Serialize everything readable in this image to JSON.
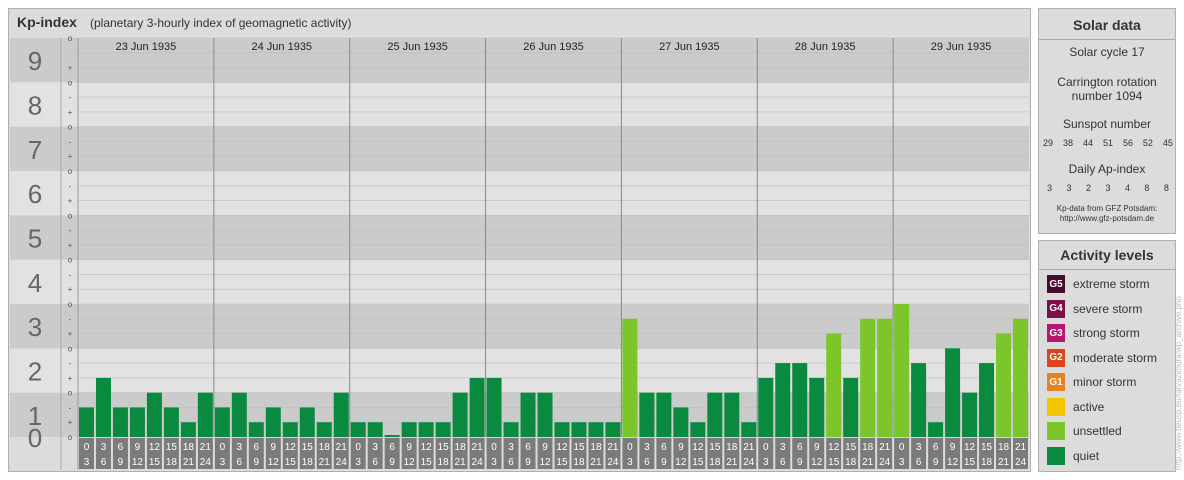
{
  "header": {
    "title": "Kp-index",
    "subtitle": "(planetary 3-hourly index of geomagnetic activity)"
  },
  "solar": {
    "title": "Solar data",
    "cycle": "Solar cycle 17",
    "carrington_line1": "Carrington rotation",
    "carrington_line2": "number 1094",
    "sunspot_title": "Sunspot number",
    "sunspot_values": [
      "29",
      "38",
      "44",
      "51",
      "56",
      "52",
      "45"
    ],
    "ap_title": "Daily Ap-index",
    "ap_values": [
      "3",
      "3",
      "2",
      "3",
      "4",
      "8",
      "8"
    ],
    "source_line1": "Kp-data from GFZ Potsdam:",
    "source_line2": "http://www.gfz-potsdam.de"
  },
  "activity": {
    "title": "Activity levels",
    "items": [
      {
        "badge": "G5",
        "label": "extreme storm",
        "color": "#4a0a2e"
      },
      {
        "badge": "G4",
        "label": "severe storm",
        "color": "#7a0f4a"
      },
      {
        "badge": "G3",
        "label": "strong storm",
        "color": "#b8166e"
      },
      {
        "badge": "G2",
        "label": "moderate storm",
        "color": "#d9461c"
      },
      {
        "badge": "G1",
        "label": "minor storm",
        "color": "#e8821e"
      },
      {
        "badge": "",
        "label": "active",
        "color": "#f5c400"
      },
      {
        "badge": "",
        "label": "unsettled",
        "color": "#7cc62c"
      },
      {
        "badge": "",
        "label": "quiet",
        "color": "#0a8a3e"
      }
    ]
  },
  "watermark": "http://www.tleusp.eu/fan/azimura/wp_archive.pho",
  "chart_data": {
    "type": "bar",
    "title": "Kp-index",
    "ylim": [
      0,
      9
    ],
    "y_ticks": [
      "0",
      "1",
      "2",
      "3",
      "4",
      "5",
      "6",
      "7",
      "8",
      "9"
    ],
    "sub_ticks": [
      "+",
      "o",
      "-"
    ],
    "days": [
      "23 Jun 1935",
      "24 Jun 1935",
      "25 Jun 1935",
      "26 Jun 1935",
      "27 Jun 1935",
      "28 Jun 1935",
      "29 Jun 1935"
    ],
    "slot_top": [
      "0",
      "3",
      "6",
      "9",
      "12",
      "15",
      "18",
      "21"
    ],
    "slot_bottom": [
      "3",
      "6",
      "9",
      "12",
      "15",
      "18",
      "21",
      "24"
    ],
    "values": [
      0.667,
      1.333,
      0.667,
      0.667,
      1.0,
      0.667,
      0.333,
      1.0,
      0.667,
      1.0,
      0.333,
      0.667,
      0.333,
      0.667,
      0.333,
      1.0,
      0.333,
      0.333,
      0.0,
      0.333,
      0.333,
      0.333,
      1.0,
      1.333,
      1.333,
      0.333,
      1.0,
      1.0,
      0.333,
      0.333,
      0.333,
      0.333,
      2.667,
      1.0,
      1.0,
      0.667,
      0.333,
      1.0,
      1.0,
      0.333,
      1.333,
      1.667,
      1.667,
      1.333,
      2.333,
      1.333,
      2.667,
      2.667,
      3.0,
      1.667,
      0.333,
      2.0,
      1.0,
      1.667,
      2.333,
      2.667
    ],
    "colors": {
      "quiet": "#0a8a3e",
      "unsettled": "#7cc62c",
      "band_dark": "#cbcbcb",
      "band_light": "#e2e2e2",
      "slot_bg": "#7b7b7b"
    }
  }
}
